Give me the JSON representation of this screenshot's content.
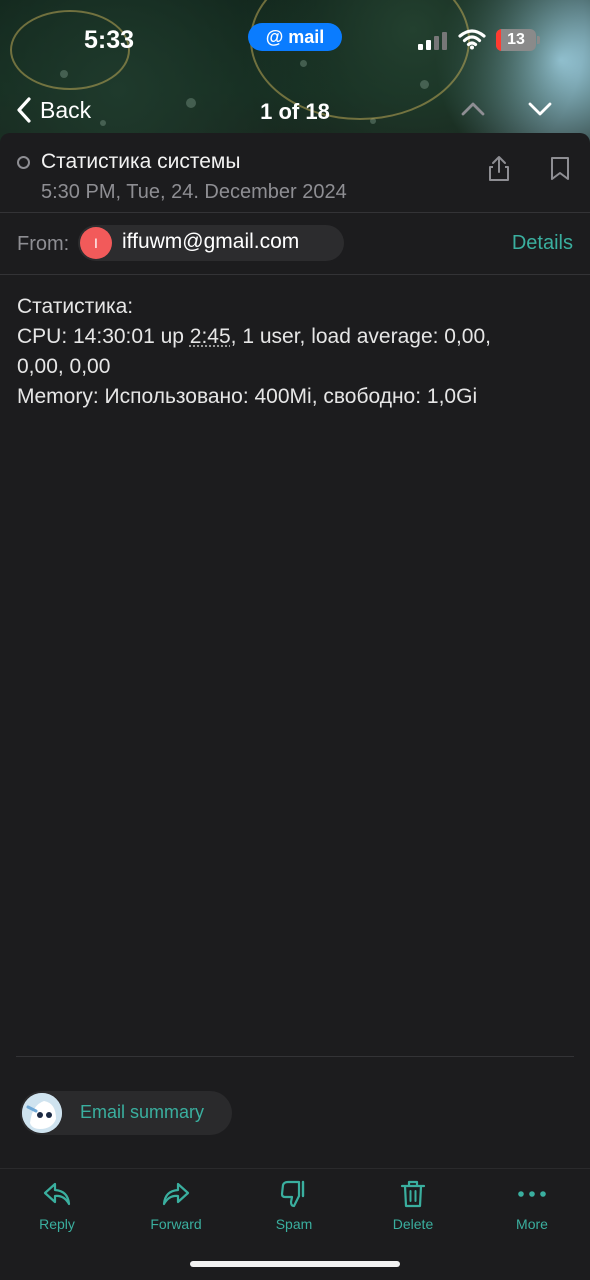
{
  "statusbar": {
    "time": "5:33",
    "app_pill": "mail",
    "battery": "13"
  },
  "nav": {
    "back_label": "Back",
    "counter": "1 of 18"
  },
  "message": {
    "subject": "Статистика системы",
    "date": "5:30 PM, Tue, 24. December 2024",
    "from_label": "From:",
    "sender_initial": "I",
    "sender": "iffuwm@gmail.com",
    "details_label": "Details",
    "body": {
      "line1": "Статистика:",
      "line2_prefix": "CPU: 14:30:01 up ",
      "line2_uptime": "2:45",
      "line2_suffix": ", 1 user, load average: 0,00,",
      "line3": "0,00, 0,00",
      "line4": "Memory: Использовано: 400Mi, свободно: 1,0Gi"
    }
  },
  "summary": {
    "label": "Email summary"
  },
  "toolbar": {
    "reply": "Reply",
    "forward": "Forward",
    "spam": "Spam",
    "delete": "Delete",
    "more": "More"
  },
  "colors": {
    "accent": "#3aaf9f",
    "pill_blue": "#0a7cff",
    "avatar_red": "#f25a5a",
    "background": "#1c1c1e"
  },
  "icons": [
    "back-chevron-icon",
    "chevron-up-icon",
    "chevron-down-icon",
    "share-icon",
    "bookmark-icon",
    "reply-icon",
    "forward-icon",
    "thumbs-down-icon",
    "trash-icon",
    "more-dots-icon"
  ]
}
